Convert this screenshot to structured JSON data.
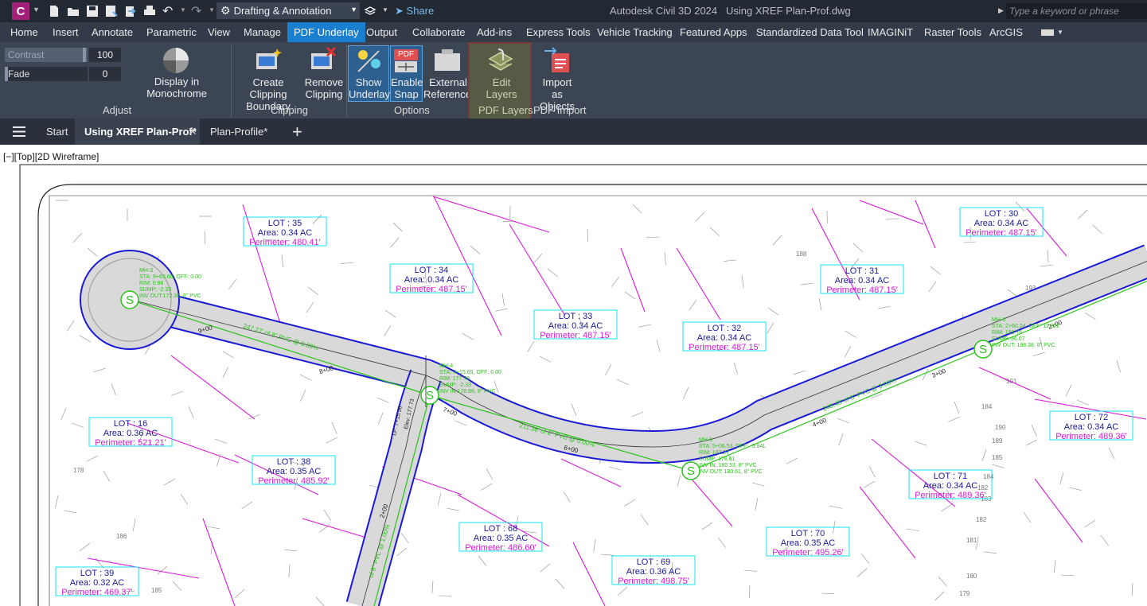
{
  "app": {
    "logo": "C",
    "title": "Autodesk Civil 3D 2024",
    "doc_title": "Using XREF Plan-Prof.dwg",
    "workspace": "Drafting & Annotation",
    "share": "Share",
    "search_placeholder": "Type a keyword or phrase"
  },
  "ribbon_tabs": [
    "Home",
    "Insert",
    "Annotate",
    "Parametric",
    "View",
    "Manage",
    "PDF Underlay",
    "Output",
    "Collaborate",
    "Add-ins",
    "Express Tools",
    "Vehicle Tracking",
    "Featured Apps",
    "Standardized Data Tool",
    "IMAGINiT",
    "Raster Tools",
    "ArcGIS"
  ],
  "ribbon": {
    "adjust": {
      "contrast_label": "Contrast",
      "contrast_value": "100",
      "fade_label": "Fade",
      "fade_value": "0",
      "monochrome": "Display in Monochrome",
      "panel": "Adjust"
    },
    "clipping": {
      "create_1": "Create Clipping",
      "create_2": "Boundary",
      "remove_1": "Remove",
      "remove_2": "Clipping",
      "panel": "Clipping"
    },
    "options": {
      "show_1": "Show",
      "show_2": "Underlay",
      "snap_1": "Enable",
      "snap_2": "Snap",
      "ext_1": "External",
      "ext_2": "References",
      "panel": "Options",
      "pdf_badge": "PDF"
    },
    "pdf_layers": {
      "edit_1": "Edit",
      "edit_2": "Layers",
      "panel": "PDF Layers"
    },
    "pdf_import": {
      "import_1": "Import",
      "import_2": "as Objects",
      "panel": "PDF Import"
    }
  },
  "doc_tabs": {
    "start": "Start",
    "active": "Using XREF Plan-Prof*",
    "other": "Plan-Profile*"
  },
  "viewport": {
    "label": "[−][Top][2D Wireframe]"
  },
  "drawing": {
    "lots": [
      {
        "lot": "LOT : 35",
        "area": "Area:  0.34  AC",
        "perim": "Perimeter:  480.41'"
      },
      {
        "lot": "LOT : 34",
        "area": "Area:  0.34  AC",
        "perim": "Perimeter:  487.15'"
      },
      {
        "lot": "LOT : 33",
        "area": "Area:  0.34  AC",
        "perim": "Perimeter:  487.15'"
      },
      {
        "lot": "LOT : 32",
        "area": "Area:  0.34  AC",
        "perim": "Perimeter:  487.15'"
      },
      {
        "lot": "LOT : 31",
        "area": "Area:  0.34  AC",
        "perim": "Perimeter:  487.15'"
      },
      {
        "lot": "LOT : 30",
        "area": "Area:  0.34  AC",
        "perim": "Perimeter:  487.15'"
      },
      {
        "lot": "LOT : 16",
        "area": "Area:  0.36  AC",
        "perim": "Perimeter:  521.21'"
      },
      {
        "lot": "LOT : 38",
        "area": "Area:  0.35  AC",
        "perim": "Perimeter:  485.92'"
      },
      {
        "lot": "LOT : 72",
        "area": "Area:  0.34  AC",
        "perim": "Perimeter:  489.36'"
      },
      {
        "lot": "LOT : 71",
        "area": "Area:  0.34  AC",
        "perim": "Perimeter:  489.36'"
      },
      {
        "lot": "LOT : 68",
        "area": "Area:  0.35  AC",
        "perim": "Perimeter:  486.60'"
      },
      {
        "lot": "LOT : 70",
        "area": "Area:  0.35  AC",
        "perim": "Perimeter:  495.26'"
      },
      {
        "lot": "LOT : 69",
        "area": "Area:  0.36  AC",
        "perim": "Perimeter:  498.75'"
      },
      {
        "lot": "LOT : 39",
        "area": "Area:  0.32  AC",
        "perim": "Perimeter:  469.37'"
      }
    ],
    "stations": [
      "9+00",
      "8+00",
      "7+00",
      "6+00",
      "4+00",
      "3+00",
      "2+00",
      "2+00"
    ],
    "manhole_symbol": "S",
    "mh3": [
      "MH-3",
      "STA: 9+63.66, OFF: 0.00",
      "RIM: 0.86",
      "SUMP: -2.33",
      "INV OUT:172.36, 8\" PVC"
    ],
    "mh4": [
      "MH-4",
      "STA: 7+15.69, OFF: 0.00",
      "RIM: 177.78",
      "SUMP: -2.33",
      "INV IN:178.86, 8\" PVC"
    ],
    "mh5": [
      "MH-5",
      "STA: 5+06.53, OFF: -9.94L",
      "RIM: 182.27",
      "SUMP: 178.61",
      "INV IN: 180.53, 8\" PVC",
      "INV OUT: 180.61, 8\" PVC"
    ],
    "mh6": [
      "MH-6",
      "STA: 2+60.24, OFF: 12.82L",
      "RIM: 191.76",
      "SUMP: 86.07",
      "INV OUT: 188.38, 8\" PVC"
    ],
    "pipes": [
      "247.27' of 8\" PVC @ 0.00%",
      "211.36' of 8\" PVC @ 0.00%",
      "248.48' of 8\" PVC @ 3.00%",
      "of 8\" PVC @ 1.00%"
    ],
    "pi_label": "LP: 7+15.30",
    "elev_label": "Elev: 177.73",
    "contours": [
      "188",
      "193",
      "191",
      "190",
      "189",
      "185",
      "184",
      "183",
      "182",
      "181",
      "180",
      "179",
      "178",
      "186",
      "185",
      "184",
      "182"
    ],
    "colors": {
      "magenta": "#d81ad8",
      "cyan": "#10e6f2",
      "green": "#2ac41a",
      "blue": "#1a1ad6",
      "road": "#d9d9d9"
    }
  }
}
